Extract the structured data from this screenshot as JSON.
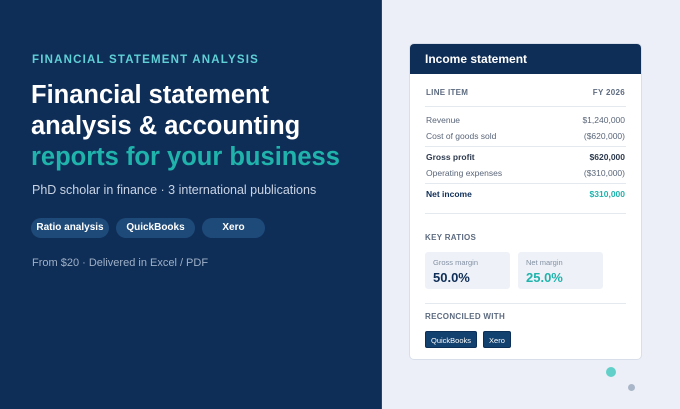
{
  "hero": {
    "eyebrow": "FINANCIAL STATEMENT ANALYSIS",
    "headline_line1": "Financial statement",
    "headline_line2": "analysis & accounting",
    "headline_accent": "reports for your business",
    "subline": "PhD scholar in finance · 3 international publications",
    "pills": [
      "Ratio analysis",
      "QuickBooks",
      "Xero"
    ],
    "footnote": "From $20 · Delivered in Excel / PDF"
  },
  "card": {
    "title": "Income statement",
    "col_item": "LINE ITEM",
    "col_period": "FY 2026",
    "rows": [
      {
        "label": "Revenue",
        "value": "$1,240,000"
      },
      {
        "label": "Cost of goods sold",
        "value": "($620,000)"
      },
      {
        "label": "Gross profit",
        "value": "$620,000"
      },
      {
        "label": "Operating expenses",
        "value": "($310,000)"
      },
      {
        "label": "Net income",
        "value": "$310,000"
      }
    ],
    "ratios_label": "KEY RATIOS",
    "ratios": [
      {
        "label": "Gross margin",
        "value": "50.0%"
      },
      {
        "label": "Net margin",
        "value": "25.0%"
      }
    ],
    "reconciled_label": "RECONCILED WITH",
    "reconciled": [
      "QuickBooks",
      "Xero"
    ]
  },
  "colors": {
    "navy": "#0f2e57",
    "teal": "#20b3ac",
    "eyebrow_teal": "#5fd0d6",
    "pill_blue": "#1e4a79",
    "page_bg": "#eceff7"
  }
}
